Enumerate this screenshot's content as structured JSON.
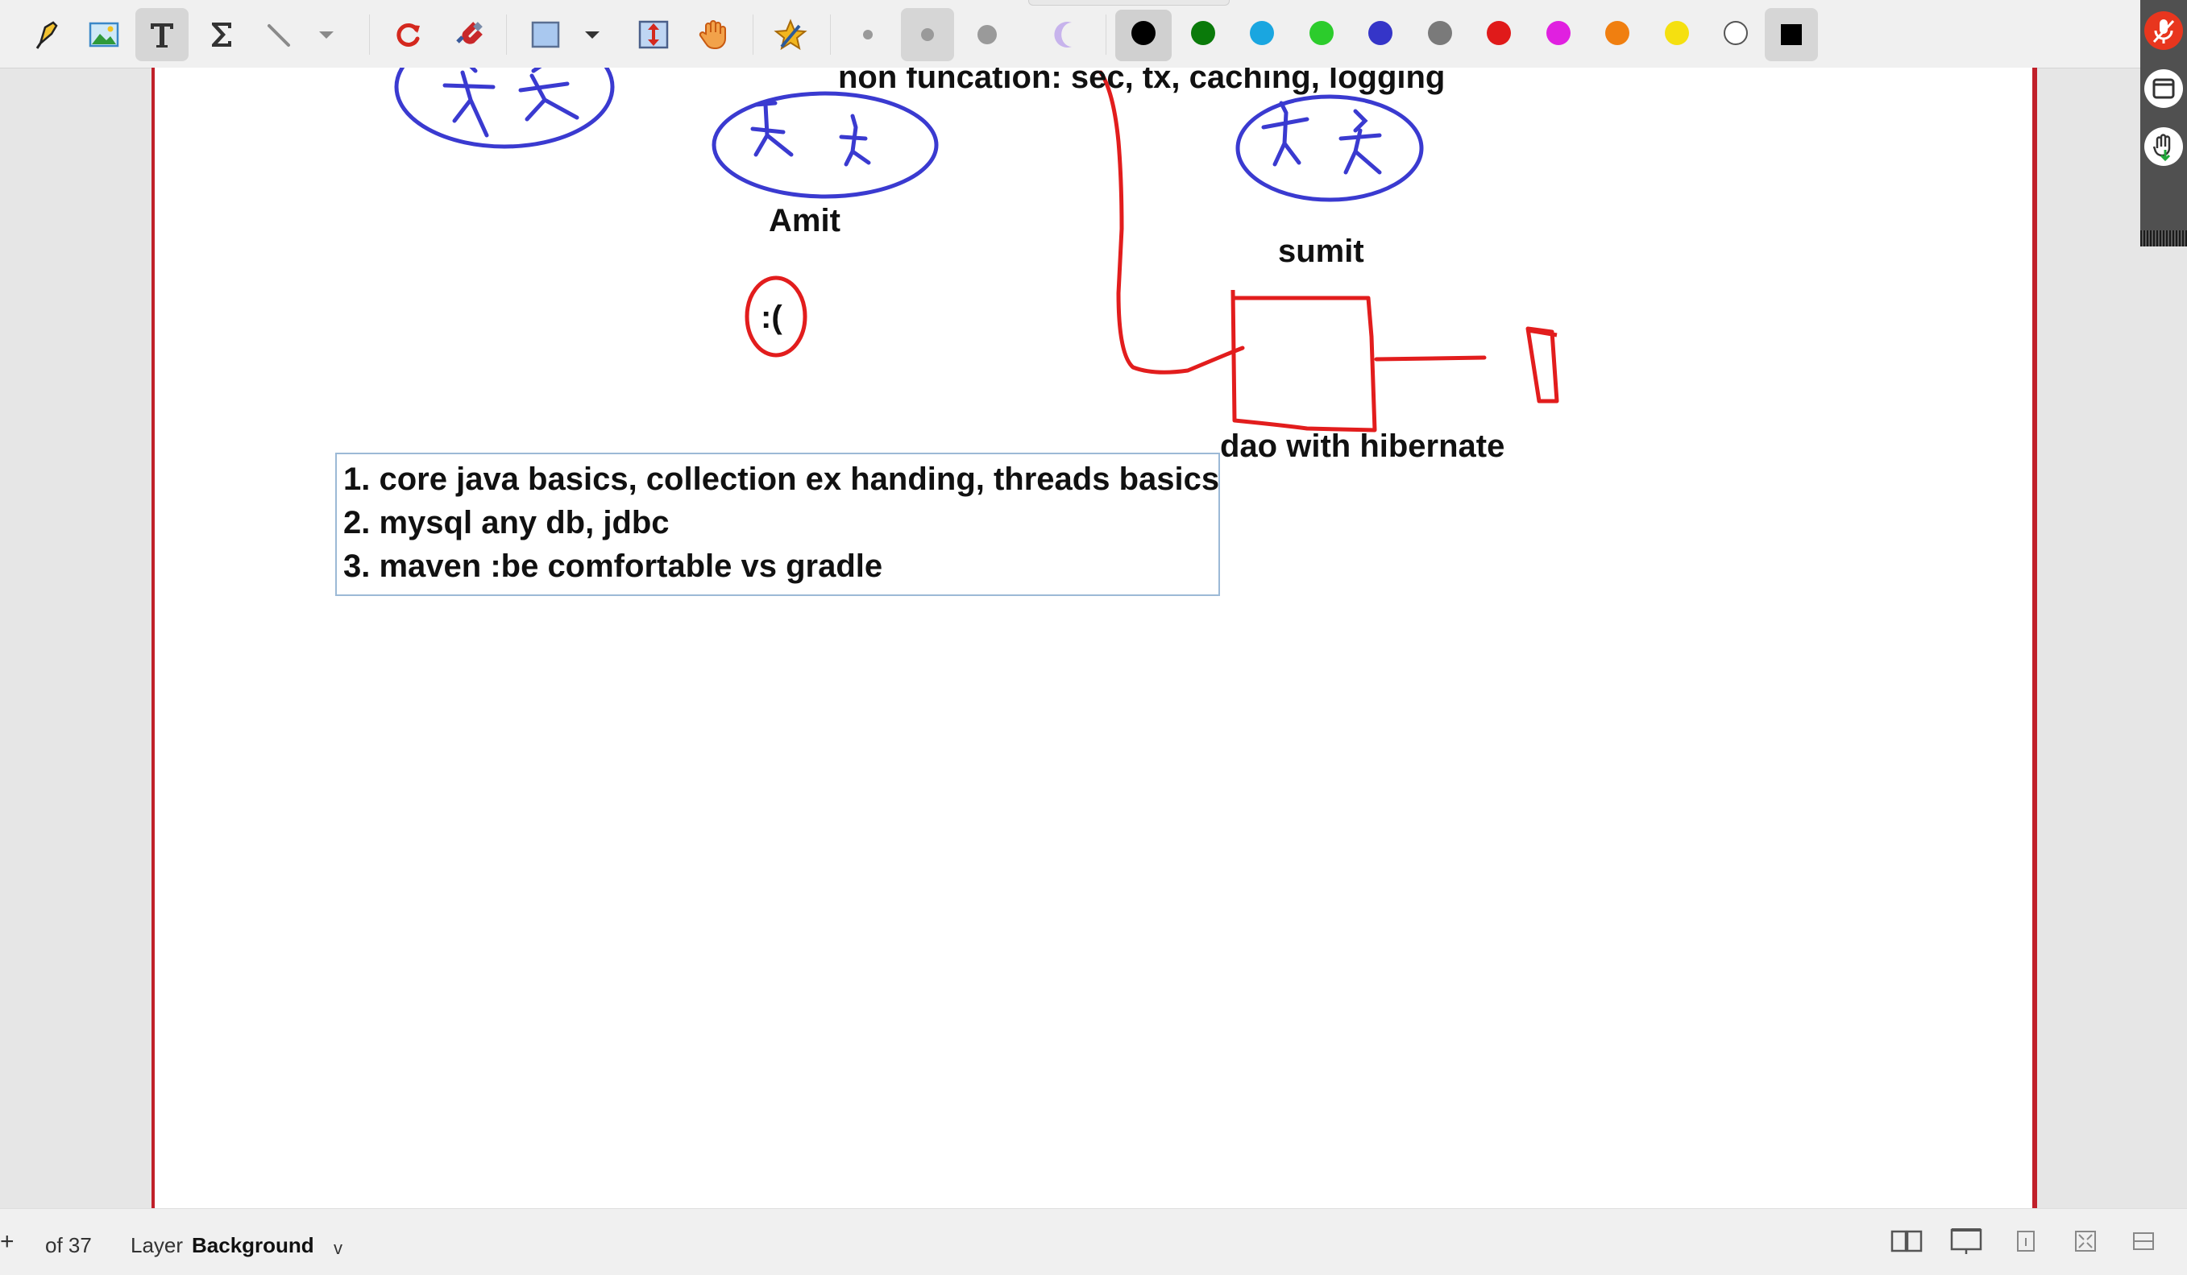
{
  "toolbar": {
    "tools": [
      {
        "name": "highlighter-tool"
      },
      {
        "name": "image-tool"
      },
      {
        "name": "text-tool",
        "active": true
      },
      {
        "name": "formula-tool"
      },
      {
        "name": "line-tool"
      },
      {
        "name": "line-options-dropdown"
      },
      {
        "name": "undo-redo-tool"
      },
      {
        "name": "magnet-tool"
      },
      {
        "name": "shape-tool"
      },
      {
        "name": "shape-options-dropdown"
      },
      {
        "name": "vertical-space-tool"
      },
      {
        "name": "hand-tool"
      },
      {
        "name": "favorites-tool"
      }
    ],
    "pen_sizes": [
      "small",
      "medium",
      "large"
    ],
    "active_pen_size": "medium",
    "colors": [
      {
        "name": "black",
        "hex": "#000000"
      },
      {
        "name": "green",
        "hex": "#0a7a0a"
      },
      {
        "name": "cyan",
        "hex": "#1aa6e0"
      },
      {
        "name": "lime",
        "hex": "#2ccc2c"
      },
      {
        "name": "blue",
        "hex": "#3535c8"
      },
      {
        "name": "gray",
        "hex": "#7a7a7a"
      },
      {
        "name": "red",
        "hex": "#e01a1a"
      },
      {
        "name": "magenta",
        "hex": "#e020e0"
      },
      {
        "name": "orange",
        "hex": "#f07f10"
      },
      {
        "name": "yellow",
        "hex": "#f5e010"
      },
      {
        "name": "white",
        "hex": "#ffffff"
      }
    ],
    "active_color": "black",
    "fill_color_hex": "#000000"
  },
  "canvas": {
    "heading": "non funcation: sec, tx, caching, logging",
    "labels": {
      "amit": "Amit",
      "sad_face": ":(",
      "sumit": "sumit",
      "dao": "dao with hibernate"
    },
    "text_box_lines": [
      "1. core java basics, collection ex handing, threads basics",
      "2. mysql any db, jdbc",
      "3. maven :be comfortable vs gradle"
    ],
    "ink_colors": {
      "blue": "#3a3ad0",
      "red": "#e21d1d"
    }
  },
  "statusbar": {
    "page_of": "of 37",
    "layer_label": "Layer",
    "layer_value": "Background",
    "layer_dropdown": "v"
  },
  "colors": {
    "page_border": "#c0202a",
    "sidebar_bg": "#505050",
    "recording_red": "#e8361e"
  }
}
